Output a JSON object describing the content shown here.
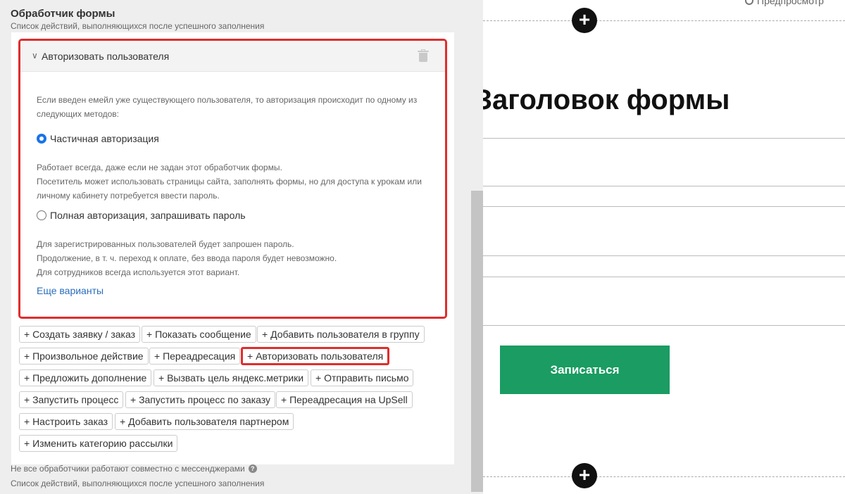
{
  "panel": {
    "title": "Обработчик формы",
    "subtitle": "Список действий, выполняющихся после успешного заполнения"
  },
  "auth": {
    "title": "Авторизовать пользователя",
    "intro_line1": "Если введен емейл уже существующего пользователя, то авторизация происходит по одному из",
    "intro_line2": "следующих методов:",
    "option1_label": "Частичная авторизация",
    "option1_selected": true,
    "option1_desc1": "Работает всегда, даже если не задан этот обработчик формы.",
    "option1_desc2": "Посетитель может использовать страницы сайта, заполнять формы, но для доступа к урокам или",
    "option1_desc3": "личному кабинету потребуется ввести пароль.",
    "option2_label": "Полная авторизация, запрашивать пароль",
    "option2_desc1": "Для зарегистрированных пользователей будет запрошен пароль.",
    "option2_desc2": "Продолжение, в т. ч. переход к оплате, без ввода пароля будет невозможно.",
    "option2_desc3": "Для сотрудников всегда используется этот вариант.",
    "more_link": "Еще варианты"
  },
  "actions": [
    "+ Создать заявку / заказ",
    "+ Показать сообщение",
    "+ Добавить пользователя в группу",
    "+ Произвольное действие",
    "+ Переадресация",
    "+ Авторизовать пользователя",
    "+ Предложить дополнение",
    "+ Вызвать цель яндекс.метрики",
    "+ Отправить письмо",
    "+ Запустить процесс",
    "+ Запустить процесс по заказу",
    "+ Переадресация на UpSell",
    "+ Настроить заказ",
    "+ Добавить пользователя партнером",
    "+ Изменить категорию рассылки"
  ],
  "footer": {
    "note": "Не все обработчики работают совместно с мессенджерами",
    "help": "?",
    "subtitle": "Список действий, выполняющихся после успешного заполнения"
  },
  "preview": {
    "link": "Предпросмотр",
    "add_symbol": "+",
    "heading": "Заголовок формы",
    "submit": "Записаться"
  },
  "colors": {
    "highlight": "#e02d2d",
    "accent_green": "#1a9c62",
    "link_blue": "#2a6ebb"
  }
}
